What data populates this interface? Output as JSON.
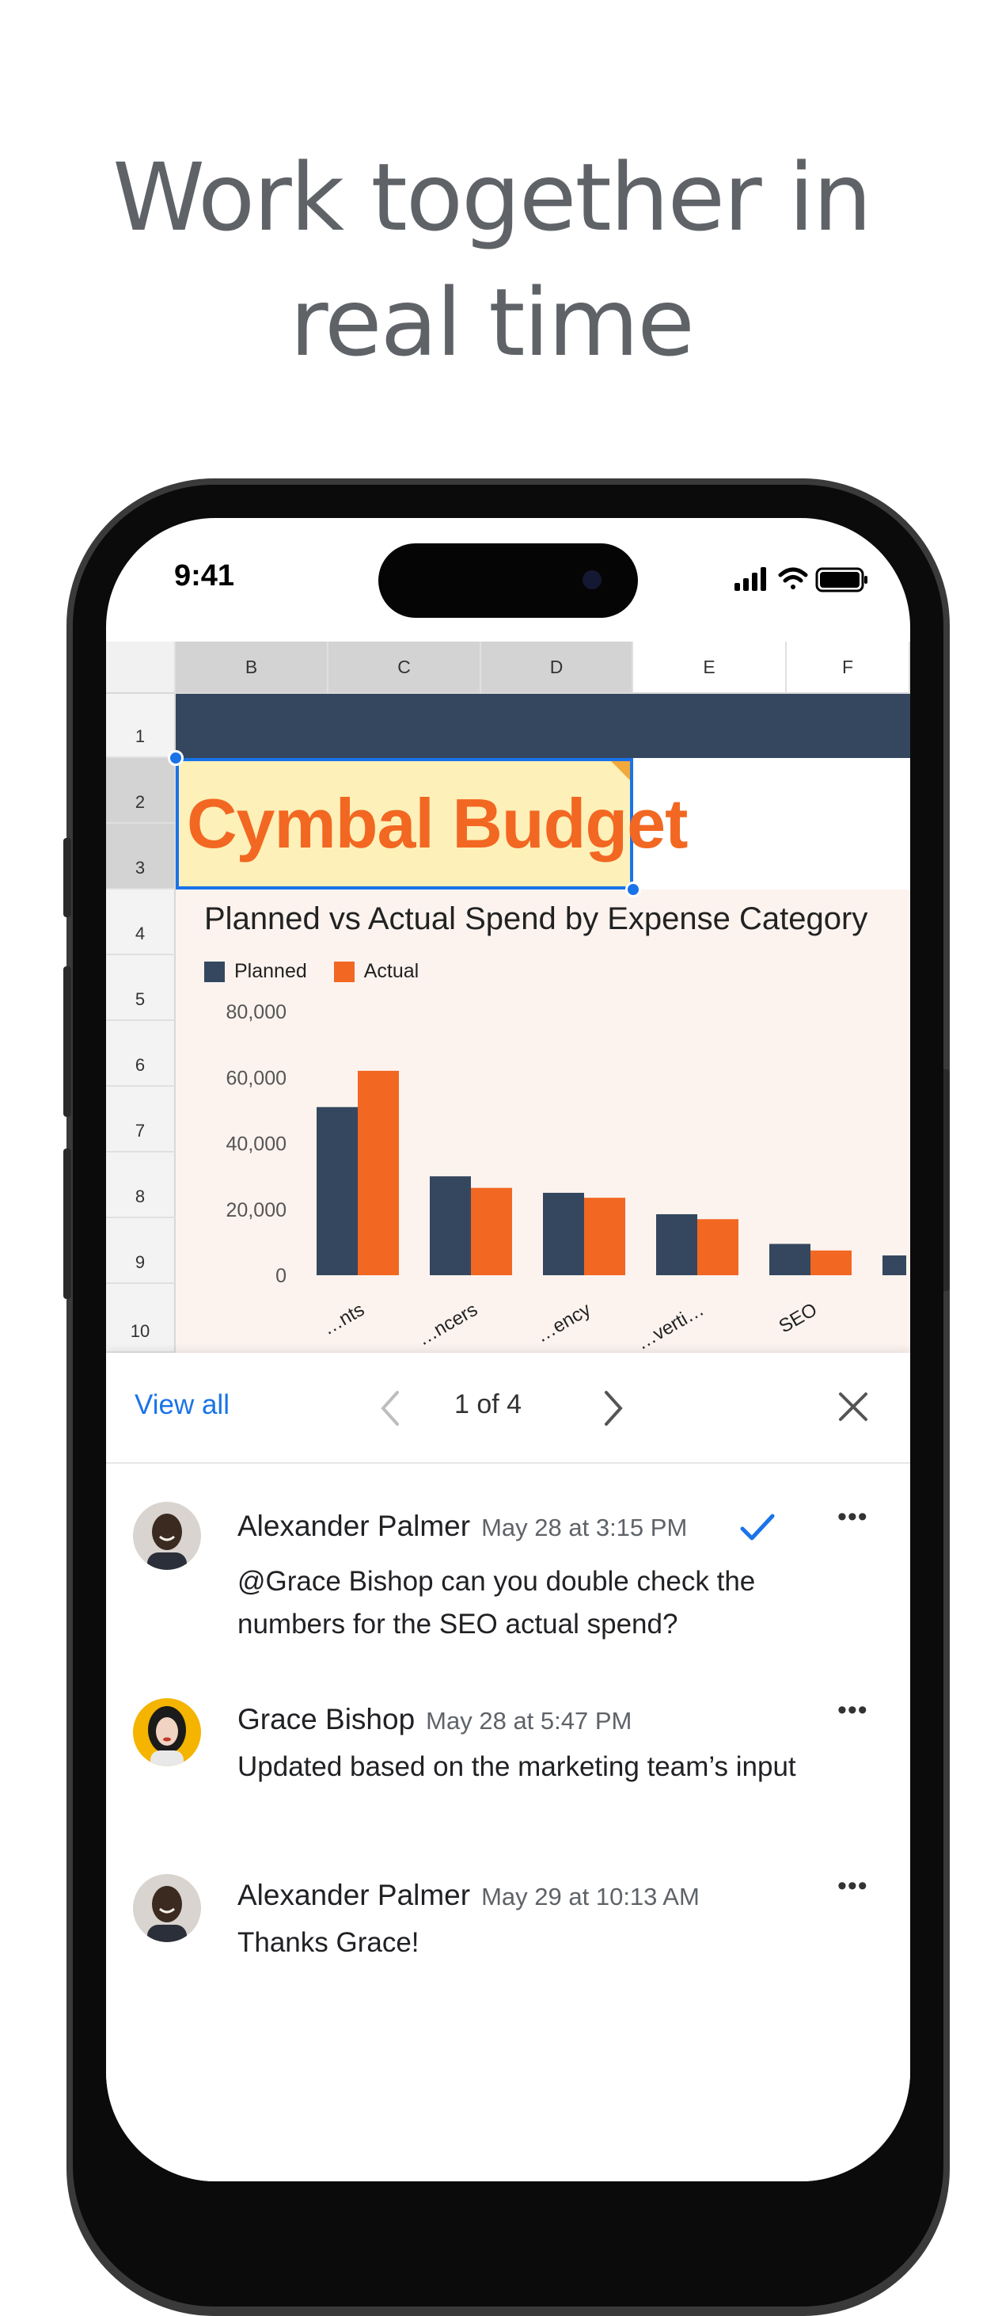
{
  "headline": {
    "line1": "Work together in",
    "line2": "real time"
  },
  "status_bar": {
    "time": "9:41"
  },
  "sheet": {
    "columns": [
      "B",
      "C",
      "D",
      "E",
      "F"
    ],
    "rows": [
      "1",
      "2",
      "3",
      "4",
      "5",
      "6",
      "7",
      "8",
      "9",
      "10"
    ],
    "title_cell": "Cymbal Budget"
  },
  "chart_data": {
    "type": "bar",
    "title": "Planned vs Actual Spend by Expense Category",
    "categories": [
      "…nts",
      "…ncers",
      "…ency",
      "…verti…",
      "SEO"
    ],
    "series": [
      {
        "name": "Planned",
        "color": "#35475f",
        "values": [
          51000,
          30000,
          25000,
          18500,
          9500
        ]
      },
      {
        "name": "Actual",
        "color": "#f26722",
        "values": [
          62000,
          26500,
          23500,
          17000,
          7500
        ]
      }
    ],
    "y_ticks": [
      "0",
      "20,000",
      "40,000",
      "60,000",
      "80,000"
    ],
    "ylim": [
      0,
      80000
    ],
    "legend": "top-left",
    "grid": false
  },
  "comments_bar": {
    "view_all": "View all",
    "pager": "1 of 4"
  },
  "comments": [
    {
      "author": "Alexander Palmer",
      "time": "May 28 at 3:15 PM",
      "text": "@Grace Bishop can you double check the numbers for the SEO actual spend?",
      "resolved": true,
      "avatar": "man-avatar"
    },
    {
      "author": "Grace Bishop",
      "time": "May 28 at 5:47 PM",
      "text": "Updated based on the marketing team’s input",
      "resolved": false,
      "avatar": "woman-avatar"
    },
    {
      "author": "Alexander Palmer",
      "time": "May 29 at 10:13 AM",
      "text": "Thanks Grace!",
      "resolved": false,
      "avatar": "man-avatar"
    }
  ],
  "colors": {
    "accent": "#1a73e8",
    "brand_orange": "#f26722",
    "navy": "#35475f"
  }
}
